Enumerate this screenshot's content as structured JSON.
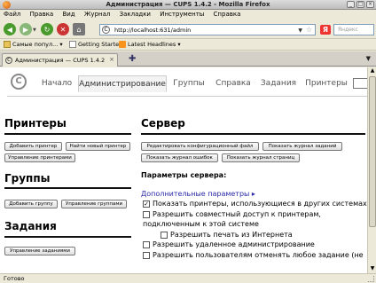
{
  "window": {
    "title": "Администрация — CUPS 1.4.2 - Mozilla Firefox"
  },
  "menu": [
    "Файл",
    "Правка",
    "Вид",
    "Журнал",
    "Закладки",
    "Инструменты",
    "Справка"
  ],
  "nav": {
    "url": "http://localhost:631/admin",
    "search_placeholder": "Яндекс"
  },
  "bookmarks": [
    {
      "label": "Самые попул... ▾",
      "icon": "folder-icon"
    },
    {
      "label": "Getting Started",
      "icon": "page-icon"
    },
    {
      "label": "Latest Headlines ▾",
      "icon": "rss-icon"
    }
  ],
  "browser_tab": {
    "label": "Администрация — CUPS 1.4.2"
  },
  "cups_tabs": [
    {
      "label": "Начало"
    },
    {
      "label": "Администрирование",
      "active": true
    },
    {
      "label": "Группы"
    },
    {
      "label": "Справка"
    },
    {
      "label": "Задания"
    },
    {
      "label": "Принтеры"
    }
  ],
  "printers": {
    "title": "Принтеры",
    "buttons": [
      "Добавить принтер",
      "Найти новый принтер",
      "Управление принтерами"
    ]
  },
  "groups": {
    "title": "Группы",
    "buttons": [
      "Добавить группу",
      "Управление группами"
    ]
  },
  "jobs": {
    "title": "Задания",
    "buttons": [
      "Управление заданиями"
    ]
  },
  "server": {
    "title": "Сервер",
    "buttons": [
      "Редактировать конфигурационный файл",
      "Показать журнал заданий",
      "Показать журнал ошибок",
      "Показать журнал страниц"
    ],
    "params_title": "Параметры сервера:",
    "advanced_link": "Дополнительные параметры ▸",
    "options": [
      {
        "label": "Показать принтеры, использующиеся в других системах",
        "checked": true
      },
      {
        "label": "Разрешить совместный доступ к принтерам,",
        "label2": "подключенным к этой системе",
        "checked": false
      },
      {
        "label": "Разрешить печать из Интернета",
        "checked": false,
        "indent": true
      },
      {
        "label": "Разрешить удаленное администрирование",
        "checked": false
      },
      {
        "label": "Разрешить пользователям отменять любое задание (не",
        "checked": false
      }
    ]
  },
  "status": "Готово"
}
